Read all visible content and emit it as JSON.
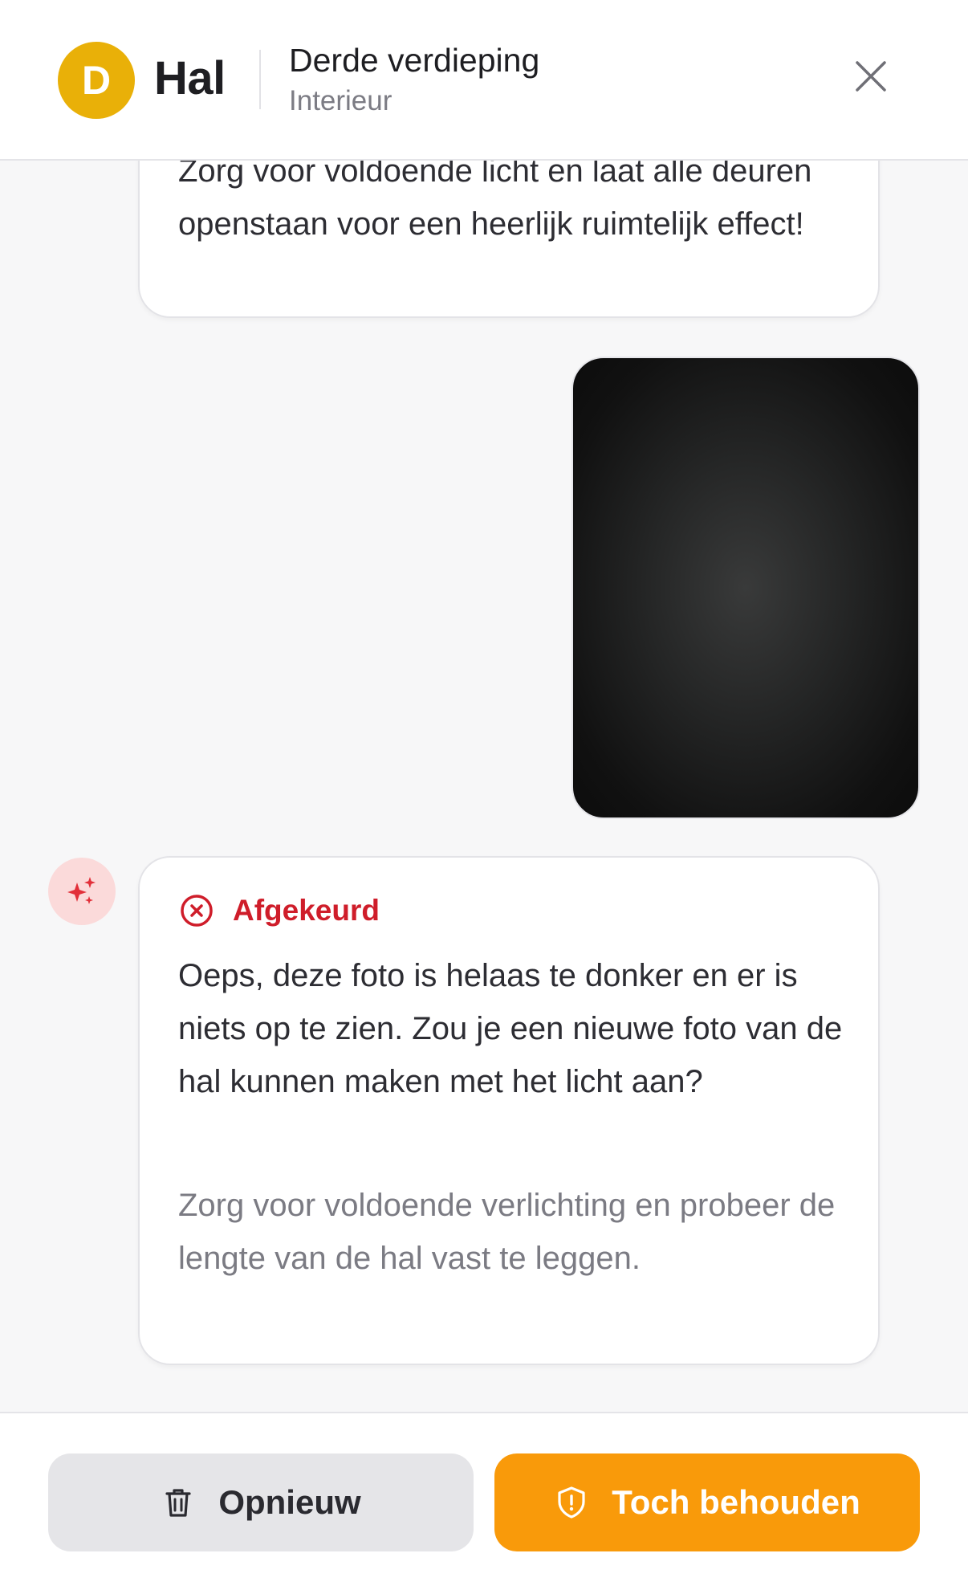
{
  "header": {
    "avatar_letter": "D",
    "room_title": "Hal",
    "floor_title": "Derde verdieping",
    "floor_subtitle": "Interieur",
    "close_icon": "close-icon"
  },
  "chat": {
    "previous_message": "Zorg voor voldoende licht en laat alle deuren openstaan voor een heerlijk ruimtelijk effect!",
    "photo_icon": "dark-photo",
    "ai_badge_icon": "sparkles-icon",
    "ai_message": {
      "status_icon": "circle-x-icon",
      "status_label": "Afgekeurd",
      "status_color": "#cf1d2a",
      "body": "Oeps, deze foto is helaas te donker en er is niets op te zien. Zou je een nieuwe foto van de hal kunnen maken met het licht aan?",
      "hint": "Zorg voor voldoende verlichting en probeer de lengte van de hal vast te leggen."
    }
  },
  "footer": {
    "retry_label": "Opnieuw",
    "retry_icon": "trash-icon",
    "keep_label": "Toch behouden",
    "keep_icon": "shield-alert-icon",
    "keep_color": "#f99a0a"
  },
  "colors": {
    "avatar": "#e9b008",
    "ai_badge_bg": "#fbdada",
    "sparkle": "#e2303a"
  }
}
